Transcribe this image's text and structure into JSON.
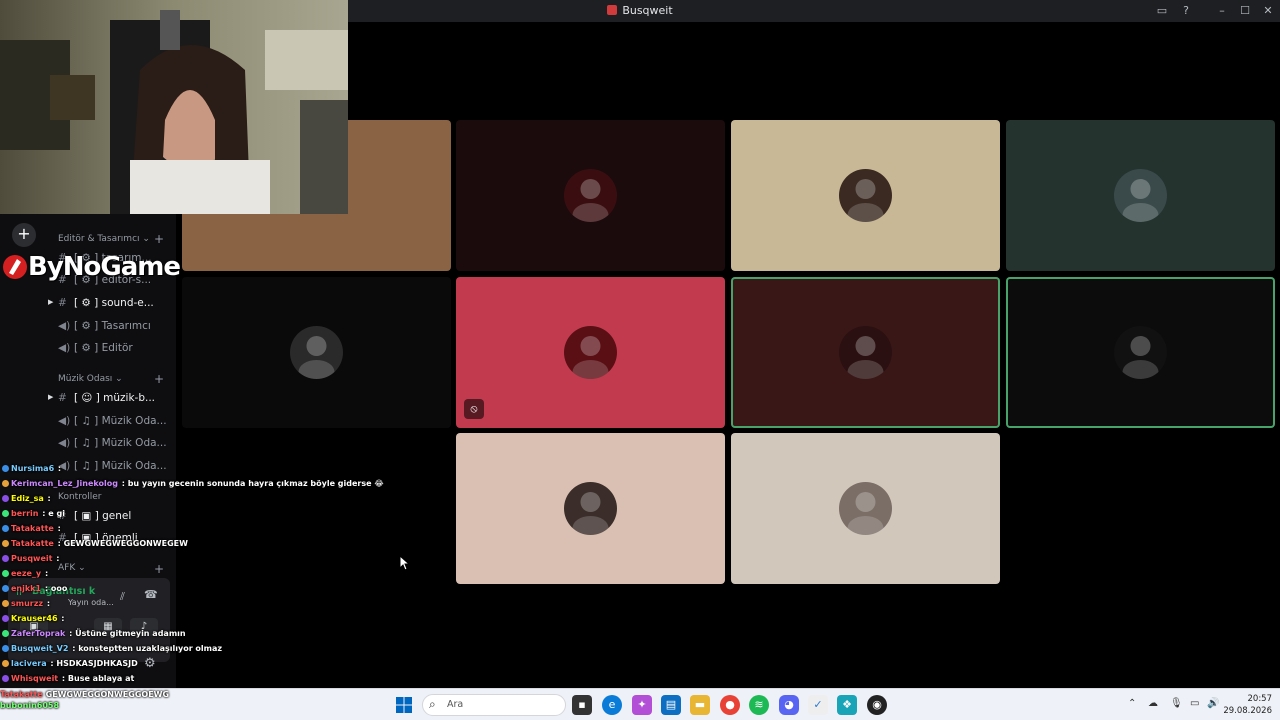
{
  "window": {
    "title": "Busqweit"
  },
  "sidebar": {
    "categories": [
      {
        "label": "Editör & Tasarımcı ⌄"
      },
      {
        "label": "Müzik Odası ⌄"
      },
      {
        "label": "Kontroller"
      },
      {
        "label": "AFK ⌄"
      }
    ],
    "channels": [
      {
        "label": "[ ⚙ ] tasarım...",
        "icon": "hash"
      },
      {
        "label": "[ ⚙ ] editör-s...",
        "icon": "hash"
      },
      {
        "label": "[ ⚙ ] sound-e...",
        "icon": "hash"
      },
      {
        "label": "[ ⚙ ] Tasarımcı",
        "icon": "speaker"
      },
      {
        "label": "[ ⚙ ] Editör",
        "icon": "speaker"
      },
      {
        "label": "[ ☺ ] müzik-b...",
        "icon": "hash"
      },
      {
        "label": "[ ♫ ] Müzik Oda...",
        "icon": "speaker"
      },
      {
        "label": "[ ♫ ] Müzik Oda...",
        "icon": "speaker"
      },
      {
        "label": "[ ♫ ] Müzik Oda...",
        "icon": "speaker"
      },
      {
        "label": "[ ▣ ] genel",
        "icon": "hash"
      },
      {
        "label": "[ ▣ ] önemli",
        "icon": "hash"
      }
    ]
  },
  "brand": {
    "text": "ByNoGame"
  },
  "voice_panel": {
    "status": "Bağlantısı k",
    "room": "Yayın oda..."
  },
  "chat": [
    {
      "user": "Nursima6",
      "color": "#7cf",
      "text": ":"
    },
    {
      "user": "Kerimcan_Lez_Jinekolog",
      "color": "#c8f",
      "text": ": bu yayın gecenin sonunda hayra çıkmaz böyle giderse 😂"
    },
    {
      "user": "Ediz_sa",
      "color": "#ff0",
      "text": ":"
    },
    {
      "user": "berrin",
      "color": "#f55",
      "text": ": e gi"
    },
    {
      "user": "Tatakatte",
      "color": "#f55",
      "text": ":"
    },
    {
      "user": "Tatakatte",
      "color": "#f55",
      "text": ": GEWGWEGWEGGONWEGEW"
    },
    {
      "user": "Pusqweit",
      "color": "#f55",
      "text": ":"
    },
    {
      "user": "eeze_y",
      "color": "#f55",
      "text": ":"
    },
    {
      "user": "enjkk1",
      "color": "#f55",
      "text": ": ooo"
    },
    {
      "user": "smurzz",
      "color": "#f55",
      "text": ":"
    },
    {
      "user": "Krauser46",
      "color": "#ff0",
      "text": ":"
    },
    {
      "user": "ZaferToprak",
      "color": "#c8f",
      "text": ": Üstüne gitmeyin adamın"
    },
    {
      "user": "Busqweit_V2",
      "color": "#7cf",
      "text": ": konsteptten uzaklaşılıyor olmaz"
    },
    {
      "user": "lacivera",
      "color": "#7cf",
      "text": ": HSDKASJDHKASJD"
    },
    {
      "user": "Whisqweit",
      "color": "#f55",
      "text": ": Buse ablaya at"
    }
  ],
  "chatbar": [
    {
      "user": "Tatakatte",
      "text": "GEWGWEGGONWEGGOEWG"
    },
    {
      "user": "bubonin6058",
      "text": ""
    }
  ],
  "video_tiles": [
    {
      "bg": "#8a6344",
      "speaking": false,
      "muted": false
    },
    {
      "bg": "#1b0b0c",
      "speaking": false,
      "muted": false
    },
    {
      "bg": "#c8b896",
      "speaking": false,
      "muted": false
    },
    {
      "bg": "#24332d",
      "speaking": false,
      "muted": false
    },
    {
      "bg": "#0a0a0a",
      "speaking": false,
      "muted": false
    },
    {
      "bg": "#c23a4e",
      "speaking": false,
      "muted": true
    },
    {
      "bg": "#3a1717",
      "speaking": true,
      "muted": false
    },
    {
      "bg": "#0c0c0c",
      "speaking": true,
      "muted": false
    },
    {
      "bg": "#d9c0b2",
      "speaking": false,
      "muted": false
    },
    {
      "bg": "#d2c7bb",
      "speaking": false,
      "muted": false
    }
  ],
  "taskbar": {
    "search_placeholder": "Ara",
    "time": "20:57",
    "date": "29.08.2026"
  },
  "colors": {
    "accent": "#5865f2",
    "speaking": "#47a36a",
    "titlebar": "#1e1f22"
  }
}
